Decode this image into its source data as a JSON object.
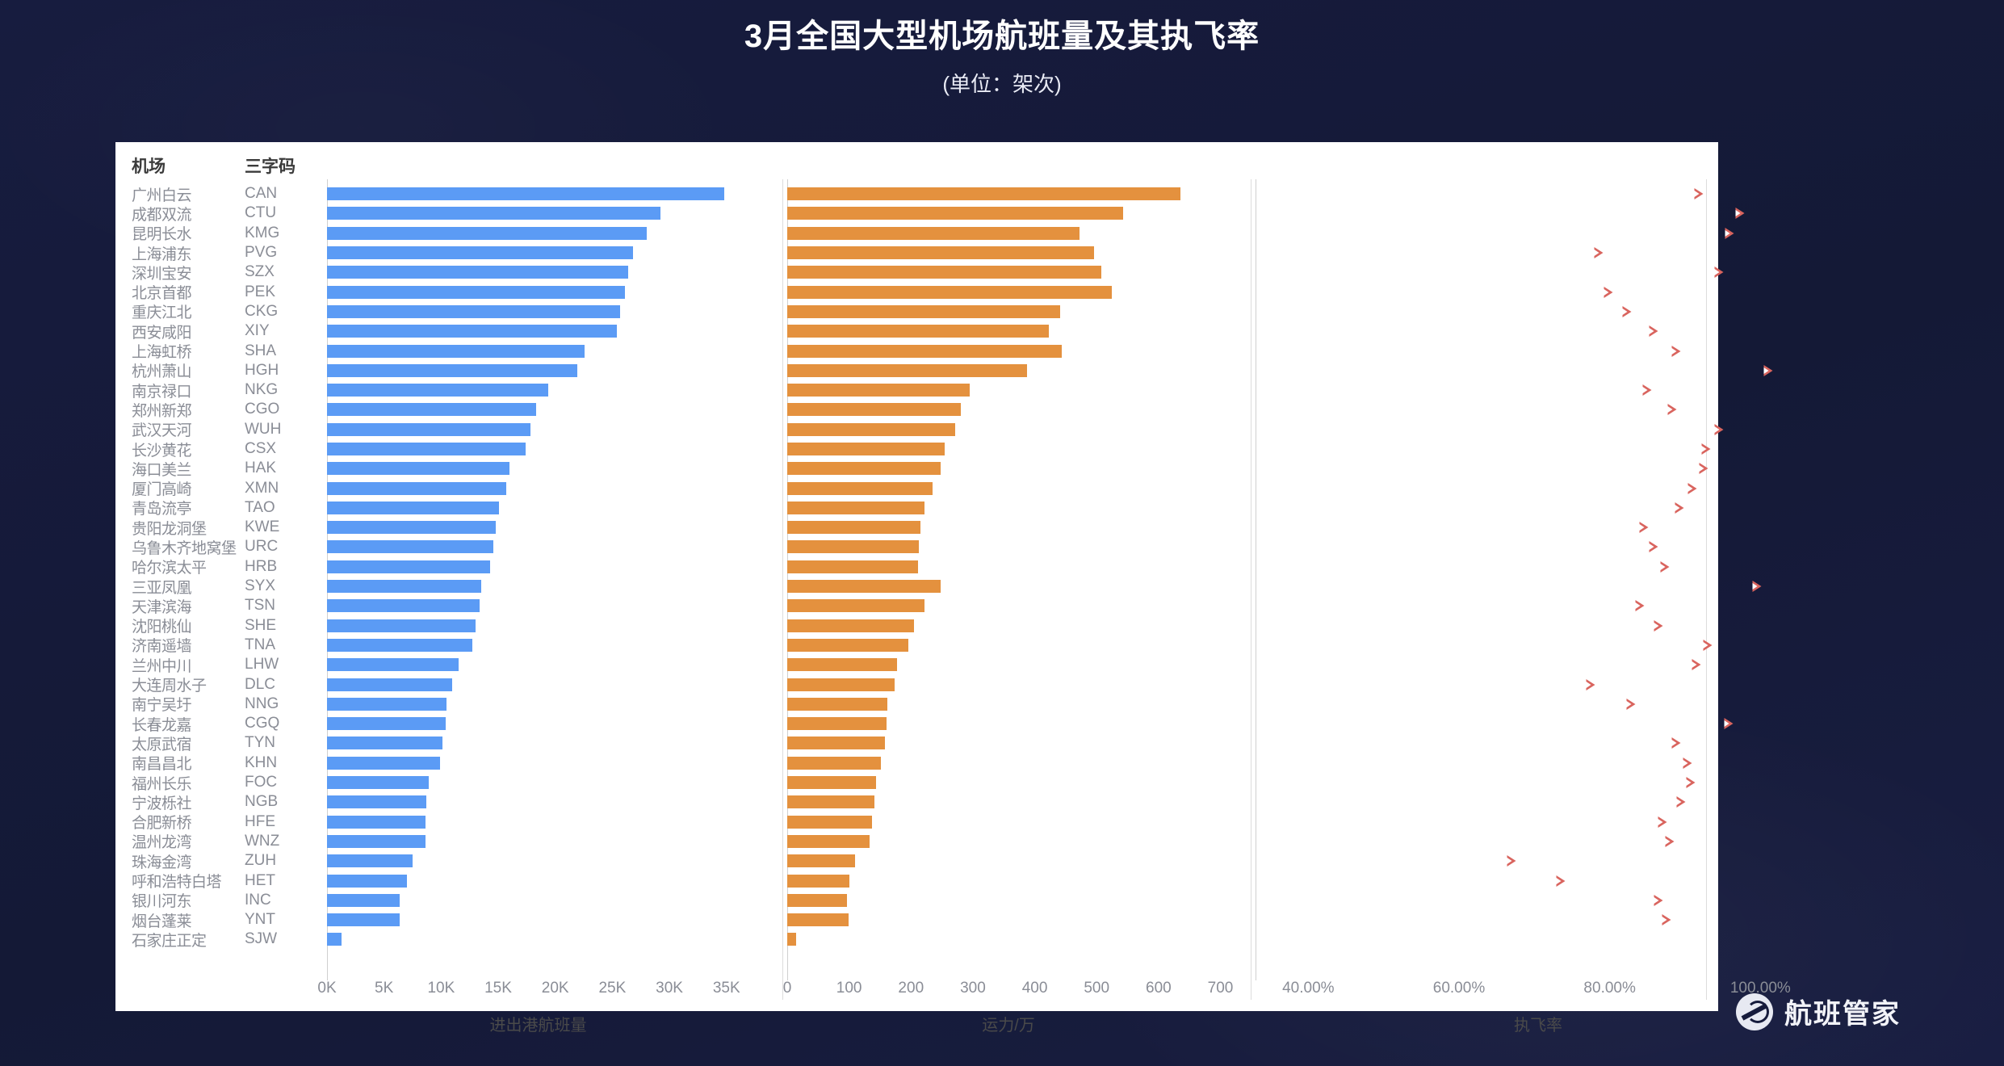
{
  "header": {
    "title": "3月全国大型机场航班量及其执飞率",
    "subtitle": "(单位：架次)"
  },
  "table_headers": {
    "airport": "机场",
    "iata": "三字码"
  },
  "branding": {
    "logo_text": "航班管家",
    "logo_icon": "globe-plane-icon"
  },
  "colors": {
    "background": "#161b3c",
    "card": "#ffffff",
    "flights_bar": "#5b9bf5",
    "capacity_bar": "#e4913e",
    "rate_marker": "#d9645e",
    "title_text": "#ffffff",
    "label_text": "#8a8d96"
  },
  "chart_data": {
    "type": "bar",
    "title": "3月全国大型机场航班量及其执飞率",
    "subtitle": "(单位：架次)",
    "layout": "three side-by-side panels sharing one categorical y-axis (40 airports, sorted descending by flight volume)",
    "grid": false,
    "legend": "none",
    "categories": [
      "广州白云",
      "成都双流",
      "昆明长水",
      "上海浦东",
      "深圳宝安",
      "北京首都",
      "重庆江北",
      "西安咸阳",
      "上海虹桥",
      "杭州萧山",
      "南京禄口",
      "郑州新郑",
      "武汉天河",
      "长沙黄花",
      "海口美兰",
      "厦门高崎",
      "青岛流亭",
      "贵阳龙洞堡",
      "乌鲁木齐地窝堡",
      "哈尔滨太平",
      "三亚凤凰",
      "天津滨海",
      "沈阳桃仙",
      "济南遥墙",
      "兰州中川",
      "大连周水子",
      "南宁吴圩",
      "长春龙嘉",
      "太原武宿",
      "南昌昌北",
      "福州长乐",
      "宁波栎社",
      "合肥新桥",
      "温州龙湾",
      "珠海金湾",
      "呼和浩特白塔",
      "银川河东",
      "烟台蓬莱",
      "石家庄正定"
    ],
    "iata_codes": [
      "CAN",
      "CTU",
      "KMG",
      "PVG",
      "SZX",
      "PEK",
      "CKG",
      "XIY",
      "SHA",
      "HGH",
      "NKG",
      "CGO",
      "WUH",
      "CSX",
      "HAK",
      "XMN",
      "TAO",
      "KWE",
      "URC",
      "HRB",
      "SYX",
      "TSN",
      "SHE",
      "TNA",
      "LHW",
      "DLC",
      "NNG",
      "CGQ",
      "TYN",
      "KHN",
      "FOC",
      "NGB",
      "HFE",
      "WNZ",
      "ZUH",
      "HET",
      "INC",
      "YNT",
      "SJW"
    ],
    "panels": [
      {
        "name": "flights",
        "xlabel": "进出港航班量",
        "ticks": [
          "0K",
          "5K",
          "10K",
          "15K",
          "20K",
          "25K",
          "30K",
          "35K"
        ],
        "tick_values": [
          0,
          5000,
          10000,
          15000,
          20000,
          25000,
          30000,
          35000
        ],
        "xlim": [
          0,
          37000
        ],
        "color": "#5b9bf5",
        "values": [
          34800,
          29200,
          28000,
          26800,
          26400,
          26100,
          25700,
          25400,
          22600,
          21900,
          19400,
          18300,
          17800,
          17400,
          16000,
          15700,
          15100,
          14800,
          14600,
          14300,
          13500,
          13400,
          13000,
          12700,
          11500,
          11000,
          10500,
          10400,
          10100,
          9900,
          8900,
          8700,
          8600,
          8600,
          7500,
          7000,
          6400,
          6400,
          1300
        ]
      },
      {
        "name": "capacity",
        "xlabel": "运力/万",
        "ticks": [
          "0",
          "100",
          "200",
          "300",
          "400",
          "500",
          "600",
          "700"
        ],
        "tick_values": [
          0,
          100,
          200,
          300,
          400,
          500,
          600,
          700
        ],
        "xlim": [
          0,
          715
        ],
        "unit": "万",
        "color": "#e4913e",
        "values": [
          635,
          543,
          472,
          496,
          508,
          525,
          441,
          423,
          443,
          388,
          295,
          281,
          272,
          255,
          248,
          235,
          222,
          215,
          213,
          212,
          248,
          222,
          205,
          196,
          178,
          173,
          162,
          161,
          158,
          152,
          143,
          141,
          137,
          133,
          110,
          101,
          97,
          99,
          15
        ]
      },
      {
        "name": "execution_rate",
        "xlabel": "执飞率",
        "ticks": [
          "40.00%",
          "60.00%",
          "80.00%",
          "100.00%"
        ],
        "tick_values": [
          40,
          60,
          80,
          100
        ],
        "xlim": [
          33,
          108
        ],
        "marker": "right-triangle-outline",
        "color": "#d9645e",
        "values": [
          91.8,
          97.3,
          95.9,
          78.5,
          94.5,
          79.8,
          82.3,
          85.8,
          88.8,
          101.0,
          85.0,
          88.3,
          94.5,
          92.8,
          92.5,
          91.0,
          89.3,
          84.5,
          85.8,
          87.3,
          99.5,
          84.0,
          86.5,
          93.0,
          91.5,
          77.5,
          82.8,
          95.8,
          88.8,
          90.3,
          90.8,
          89.5,
          87.0,
          88.0,
          67.0,
          73.5,
          86.5,
          87.5,
          null
        ]
      }
    ]
  }
}
